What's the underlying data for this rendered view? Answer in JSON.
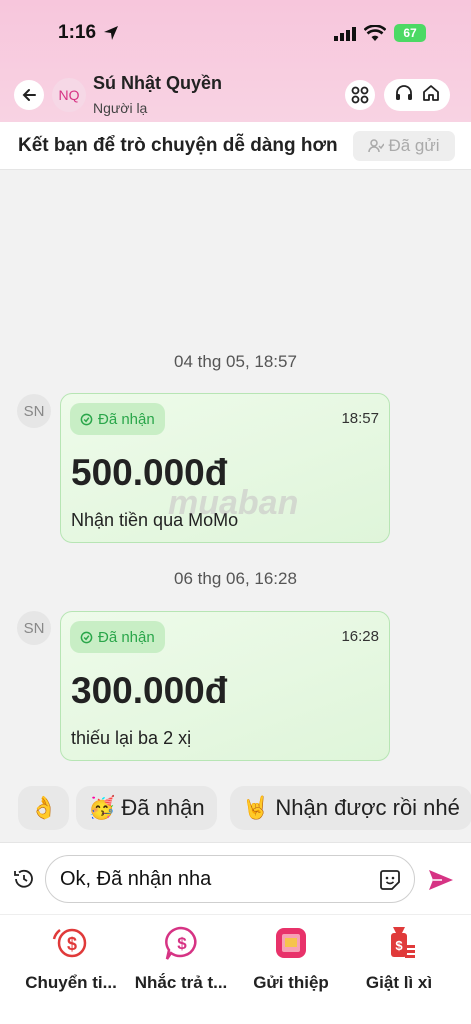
{
  "status_bar": {
    "time": "1:16",
    "battery": "67"
  },
  "header": {
    "back_icon": "arrow-left-icon",
    "avatar_initials": "NQ",
    "name": "Sú Nhật Quyền",
    "subtitle": "Người lạ"
  },
  "friend_bar": {
    "text": "Kết bạn để trò chuyện dễ dàng hơn",
    "button": "Đã gửi"
  },
  "messages": [
    {
      "date": "04 thg 05, 18:57",
      "avatar": "SN",
      "status": "Đã nhận",
      "time": "18:57",
      "amount": "500.000đ",
      "note": "Nhận tiền qua MoMo"
    },
    {
      "date": "06 thg 06, 16:28",
      "avatar": "SN",
      "status": "Đã nhận",
      "time": "16:28",
      "amount": "300.000đ",
      "note": "thiếu lại ba 2 xị"
    }
  ],
  "watermark": "muaban",
  "quick_replies": [
    {
      "emoji": "👌",
      "label": ""
    },
    {
      "emoji": "🥳",
      "label": "Đã nhận"
    },
    {
      "emoji": "🤘",
      "label": "Nhận được rồi nhé"
    }
  ],
  "composer": {
    "value": "Ok, Đã nhận nha"
  },
  "tools": [
    {
      "label": "Chuyển ti...",
      "icon": "money-transfer-icon"
    },
    {
      "label": "Nhắc trả t...",
      "icon": "payment-reminder-icon"
    },
    {
      "label": "Gửi thiệp",
      "icon": "greeting-card-icon"
    },
    {
      "label": "Giật lì xì",
      "icon": "lucky-money-icon"
    }
  ],
  "colors": {
    "accent": "#d63384",
    "received_green": "#2aa64a",
    "card_border": "#b7e5b4"
  }
}
